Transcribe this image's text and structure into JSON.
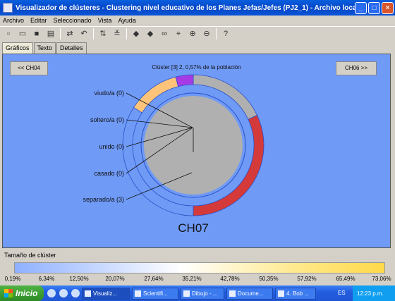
{
  "window": {
    "title": "Visualizador de clústeres - Clustering nivel educativo de los Planes Jefas/Jefes (PJ2_1) - Archivo local: general I...",
    "controls": [
      "_",
      "□",
      "×"
    ]
  },
  "menu": [
    "Archivo",
    "Editar",
    "Seleccionado",
    "Vista",
    "Ayuda"
  ],
  "toolbar_icons": [
    "new-icon",
    "open-icon",
    "save-icon",
    "print-icon",
    "refresh-icon",
    "undo-icon",
    "sort-icon",
    "filter-icon",
    "back-icon",
    "forward-icon",
    "binoculars-icon",
    "select-icon",
    "zoom-in-icon",
    "zoom-out-icon",
    "help-icon"
  ],
  "tabs": [
    "Gráficos",
    "Texto",
    "Detalles"
  ],
  "nav": {
    "prev": "<< CH04",
    "next": "CH06 >>"
  },
  "cluster": {
    "header": "Clúster [3] 2, 0,57% de la población",
    "name": "CH07"
  },
  "chart_data": {
    "type": "pie",
    "title": "Clúster [3] 2, 0,57% de la población",
    "labels": [
      "viudo/a (0)",
      "soltero/a (0)",
      "unido (0)",
      "casado (0)",
      "separado/a (3)"
    ],
    "categories": [
      "viudo/a",
      "soltero/a",
      "unido",
      "casado",
      "separado/a"
    ],
    "values": [
      0,
      0,
      0,
      0,
      3
    ],
    "outer_ring": {
      "segments": [
        {
          "color": "#b0b0b0",
          "fraction": 0.18
        },
        {
          "color": "#d43a3a",
          "fraction": 0.32
        },
        {
          "color": "#6f9af6",
          "fraction": 0.34
        },
        {
          "color": "#ffc47a",
          "fraction": 0.12
        },
        {
          "color": "#a63be6",
          "fraction": 0.04
        }
      ]
    },
    "inner_color": "#b0b0b0"
  },
  "legend": {
    "label": "Tamaño de clúster",
    "ticks": [
      "0,19%",
      "6,34%",
      "12,50%",
      "20,07%",
      "27,64%",
      "35,21%",
      "42,78%",
      "50,35%",
      "57,92%",
      "65,49%",
      "73,06%"
    ]
  },
  "taskbar": {
    "start": "Inicio",
    "tasks": [
      "Visualiz...",
      "Scientifi...",
      "Dibujo - ...",
      "Docume...",
      "4. Bob ..."
    ],
    "lang": "ES",
    "clock": "12:23 p.m."
  },
  "colors": {
    "panel": "#6f9af6",
    "accent_red": "#d43a3a"
  }
}
